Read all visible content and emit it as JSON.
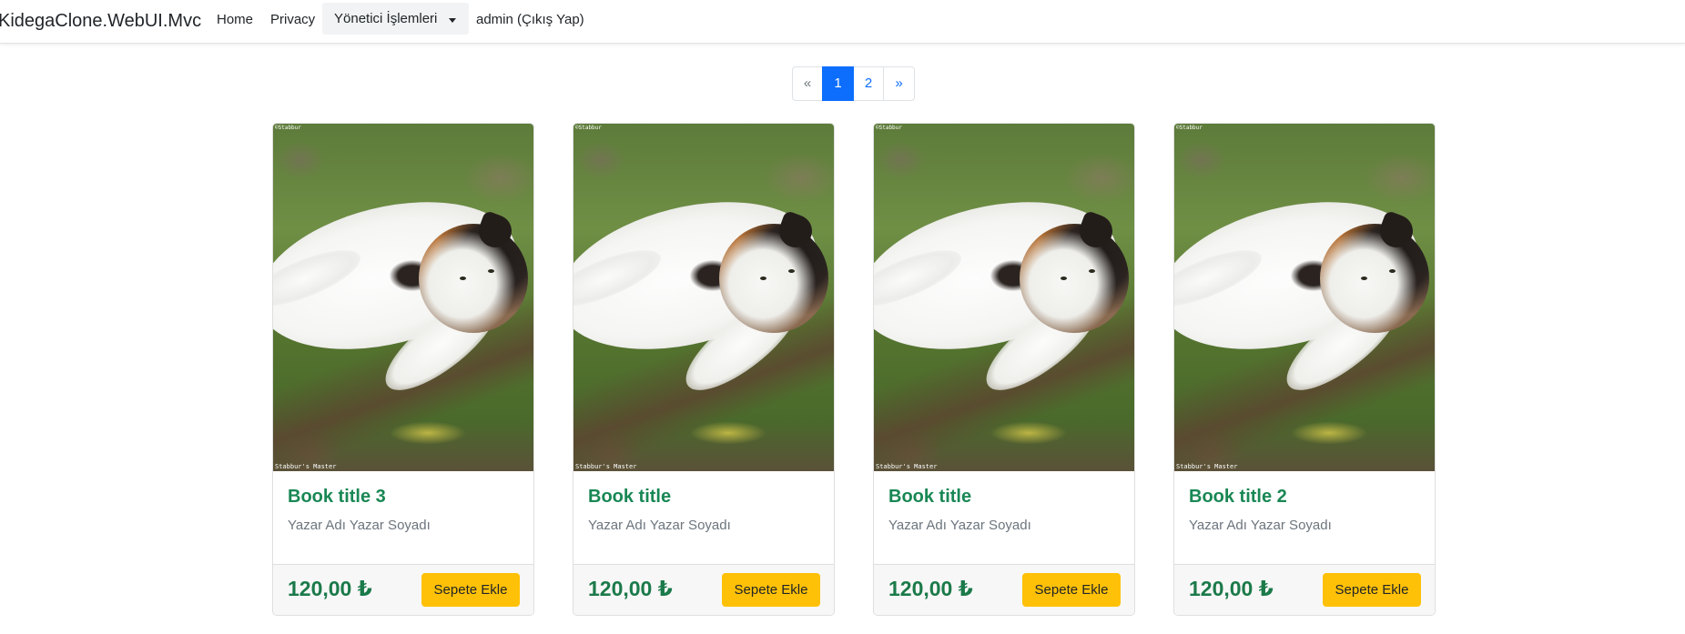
{
  "navbar": {
    "brand": "KidegaClone.WebUI.Mvc",
    "links": [
      "Home",
      "Privacy"
    ],
    "admin_menu": "Yönetici İşlemleri",
    "user_link": "admin (Çıkış Yap)"
  },
  "pagination": {
    "prev": "«",
    "pages": [
      "1",
      "2"
    ],
    "next": "»",
    "active_page": "1"
  },
  "image_watermark": "Stabbur's Master",
  "image_corner_text": "©Stabbur",
  "cards": [
    {
      "title": "Book title 3",
      "author": "Yazar Adı Yazar Soyadı",
      "price": "120,00 ₺",
      "button": "Sepete Ekle"
    },
    {
      "title": "Book title",
      "author": "Yazar Adı Yazar Soyadı",
      "price": "120,00 ₺",
      "button": "Sepete Ekle"
    },
    {
      "title": "Book title",
      "author": "Yazar Adı Yazar Soyadı",
      "price": "120,00 ₺",
      "button": "Sepete Ekle"
    },
    {
      "title": "Book title 2",
      "author": "Yazar Adı Yazar Soyadı",
      "price": "120,00 ₺",
      "button": "Sepete Ekle"
    }
  ],
  "colors": {
    "title_green": "#198754",
    "button_yellow": "#ffc107",
    "pagination_active": "#0d6efd"
  }
}
